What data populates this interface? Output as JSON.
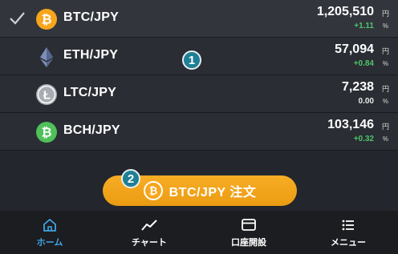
{
  "colors": {
    "btc": "#f7a51c",
    "eth": "#6b7ea8",
    "ltc": "#9ea2a8",
    "bch": "#4fc05a",
    "positive": "#4ec46c",
    "accent": "#3fa5e6",
    "order_button": "#f0a21a"
  },
  "markets": [
    {
      "pair": "BTC/JPY",
      "price": "1,205,510",
      "unit": "円",
      "change": "+1.11",
      "pct": "%",
      "icon": "bitcoin-icon",
      "selected": true
    },
    {
      "pair": "ETH/JPY",
      "price": "57,094",
      "unit": "円",
      "change": "+0.84",
      "pct": "%",
      "icon": "ethereum-icon",
      "selected": false
    },
    {
      "pair": "LTC/JPY",
      "price": "7,238",
      "unit": "円",
      "change": "0.00",
      "pct": "%",
      "icon": "litecoin-icon",
      "selected": false
    },
    {
      "pair": "BCH/JPY",
      "price": "103,146",
      "unit": "円",
      "change": "+0.32",
      "pct": "%",
      "icon": "bitcoin-cash-icon",
      "selected": false
    }
  ],
  "callouts": {
    "one": "1",
    "two": "2"
  },
  "order_button": {
    "label": "BTC/JPY 注文",
    "icon": "bitcoin-icon"
  },
  "tabs": [
    {
      "label": "ホーム",
      "icon": "home-icon",
      "active": true
    },
    {
      "label": "チャート",
      "icon": "chart-icon",
      "active": false
    },
    {
      "label": "口座開設",
      "icon": "card-icon",
      "active": false
    },
    {
      "label": "メニュー",
      "icon": "menu-icon",
      "active": false
    }
  ]
}
